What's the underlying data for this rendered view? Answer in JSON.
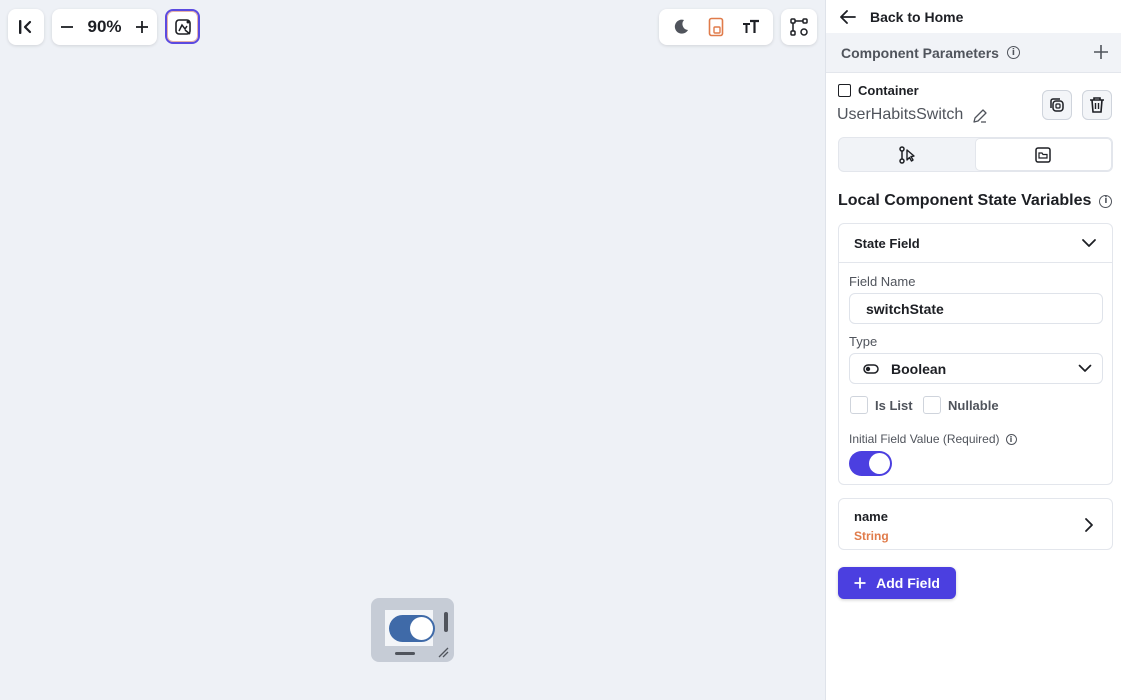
{
  "toolbar": {
    "zoom_level": "90%",
    "icons": [
      "collapse-sidebar-icon",
      "zoom-out-icon",
      "zoom-in-icon",
      "ai-sparkle-icon",
      "dark-mode-icon",
      "device-preview-icon",
      "text-scale-icon",
      "component-tree-icon"
    ],
    "accent_color": "#5b4ae0",
    "preview_color": "#e07b4a"
  },
  "panel": {
    "back_label": "Back to Home",
    "params_label": "Component Parameters",
    "component_type": "Container",
    "component_name": "UserHabitsSwitch",
    "section_title": "Local Component State Variables",
    "state_field": {
      "header": "State Field",
      "field_name_label": "Field Name",
      "field_name_value": "switchState",
      "type_label": "Type",
      "type_value": "Boolean",
      "is_list_label": "Is List",
      "nullable_label": "Nullable",
      "initial_value_label": "Initial Field Value (Required)",
      "initial_value": true
    },
    "fields": [
      {
        "name": "name",
        "type": "String"
      }
    ],
    "add_field_label": "Add Field",
    "primary_color": "#4b3fe0"
  }
}
